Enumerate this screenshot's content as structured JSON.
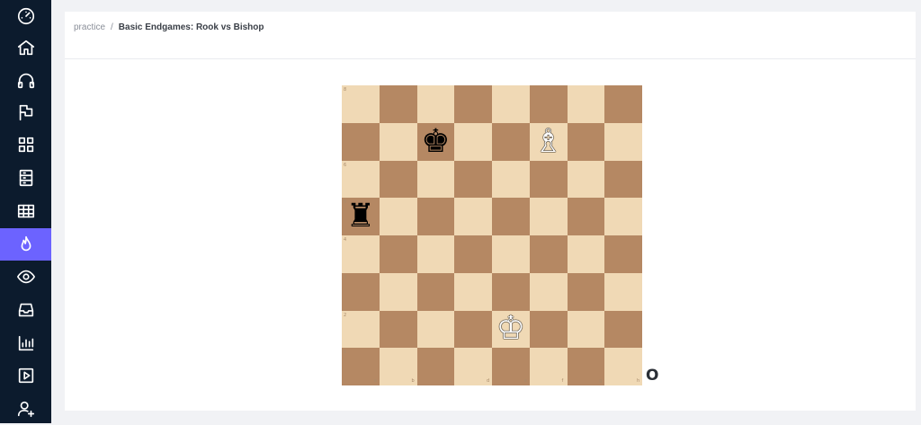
{
  "sidebar": {
    "items": [
      {
        "name": "speedometer-icon"
      },
      {
        "name": "home-icon"
      },
      {
        "name": "headphones-icon"
      },
      {
        "name": "flag-icon"
      },
      {
        "name": "grid-icon"
      },
      {
        "name": "server-icon"
      },
      {
        "name": "table-icon"
      },
      {
        "name": "flame-icon",
        "active": true
      },
      {
        "name": "eye-icon"
      },
      {
        "name": "inbox-icon"
      },
      {
        "name": "bar-chart-icon"
      },
      {
        "name": "play-icon"
      },
      {
        "name": "user-plus-icon"
      }
    ],
    "active_color": "#6c63ff"
  },
  "breadcrumb": {
    "parent": "practice",
    "separator": "/",
    "current": "Basic Endgames: Rook vs Bishop"
  },
  "board": {
    "files": [
      "a",
      "b",
      "c",
      "d",
      "e",
      "f",
      "g",
      "h"
    ],
    "ranks": [
      "8",
      "7",
      "6",
      "5",
      "4",
      "3",
      "2",
      "1"
    ],
    "light_color": "#f0d9b5",
    "dark_color": "#b58863",
    "pieces": [
      {
        "square": "c7",
        "color": "black",
        "type": "king",
        "glyph": "♚"
      },
      {
        "square": "f7",
        "color": "white",
        "type": "bishop",
        "glyph": "♗"
      },
      {
        "square": "a5",
        "color": "black",
        "type": "rook",
        "glyph": "♜"
      },
      {
        "square": "e2",
        "color": "white",
        "type": "king",
        "glyph": "♔"
      }
    ]
  },
  "outside_mark": "O"
}
